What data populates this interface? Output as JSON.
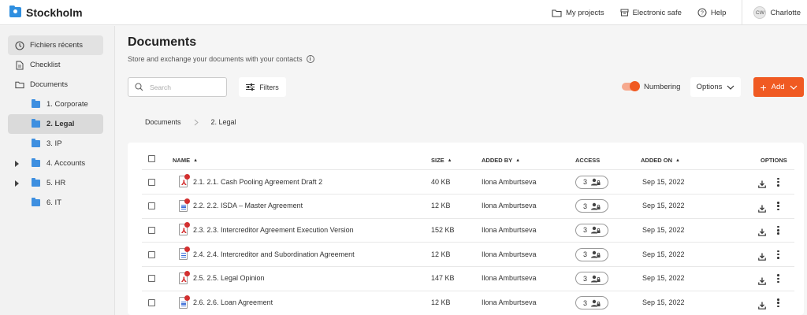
{
  "app": {
    "name": "Stockholm"
  },
  "topnav": {
    "my_projects": "My projects",
    "electronic_safe": "Electronic safe",
    "help": "Help",
    "user_initials": "CW",
    "user_name": "Charlotte"
  },
  "sidebar": {
    "items": [
      {
        "label": "Fichiers récents",
        "icon": "clock-icon"
      },
      {
        "label": "Checklist",
        "icon": "document-icon"
      },
      {
        "label": "Documents",
        "icon": "folder-outline-icon"
      }
    ],
    "folders": [
      {
        "label": "1. Corporate",
        "expandable": false
      },
      {
        "label": "2. Legal",
        "expandable": false,
        "selected": true
      },
      {
        "label": "3. IP",
        "expandable": false
      },
      {
        "label": "4. Accounts",
        "expandable": true
      },
      {
        "label": "5. HR",
        "expandable": true
      },
      {
        "label": "6. IT",
        "expandable": false
      }
    ]
  },
  "page": {
    "title": "Documents",
    "subtitle": "Store and exchange your documents with your contacts"
  },
  "toolbar": {
    "search_placeholder": "Search",
    "filters_label": "Filters",
    "numbering_label": "Numbering",
    "numbering_on": true,
    "options_label": "Options",
    "add_label": "Add"
  },
  "breadcrumb": {
    "root": "Documents",
    "current": "2. Legal"
  },
  "table": {
    "headers": {
      "name": "NAME",
      "size": "SIZE",
      "added_by": "ADDED BY",
      "access": "ACCESS",
      "added_on": "ADDED ON",
      "options": "OPTIONS"
    },
    "rows": [
      {
        "name": "2.1. 2.1. Cash Pooling Agreement Draft 2",
        "type": "pdf",
        "size": "40 KB",
        "added_by": "Ilona Amburtseva",
        "access": "3",
        "added_on": "Sep 15, 2022"
      },
      {
        "name": "2.2. 2.2. ISDA – Master Agreement",
        "type": "doc",
        "size": "12 KB",
        "added_by": "Ilona Amburtseva",
        "access": "3",
        "added_on": "Sep 15, 2022"
      },
      {
        "name": "2.3. 2.3. Intercreditor Agreement Execution Version",
        "type": "pdf",
        "size": "152 KB",
        "added_by": "Ilona Amburtseva",
        "access": "3",
        "added_on": "Sep 15, 2022"
      },
      {
        "name": "2.4. 2.4. Intercreditor and Subordination Agreement",
        "type": "doc",
        "size": "12 KB",
        "added_by": "Ilona Amburtseva",
        "access": "3",
        "added_on": "Sep 15, 2022"
      },
      {
        "name": "2.5. 2.5. Legal Opinion",
        "type": "pdf",
        "size": "147 KB",
        "added_by": "Ilona Amburtseva",
        "access": "3",
        "added_on": "Sep 15, 2022"
      },
      {
        "name": "2.6. 2.6. Loan Agreement",
        "type": "doc",
        "size": "12 KB",
        "added_by": "Ilona Amburtseva",
        "access": "3",
        "added_on": "Sep 15, 2022"
      }
    ]
  },
  "colors": {
    "accent": "#f05a22",
    "brand": "#2f8fe0",
    "folder": "#3e8fe0",
    "pdf": "#d32f2f"
  }
}
